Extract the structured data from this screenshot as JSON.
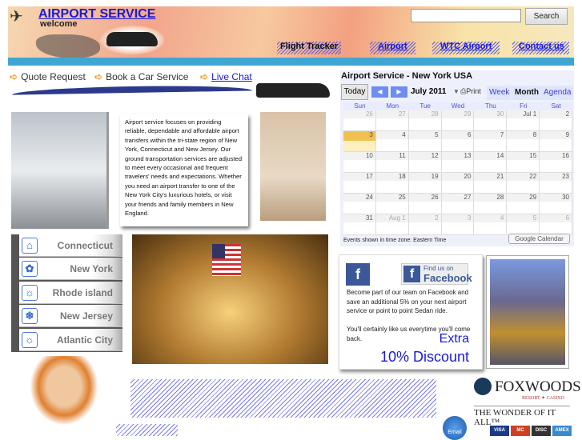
{
  "header": {
    "title": "AIRPORT SERVICE",
    "subtitle": "welcome",
    "search_placeholder": "",
    "search_button": "Search",
    "nav": [
      {
        "label": "Flight Tracker"
      },
      {
        "label": "Airport"
      },
      {
        "label": "WTC Airport"
      },
      {
        "label": "Contact us"
      }
    ]
  },
  "quick_links": [
    {
      "label": "Quote Request"
    },
    {
      "label": "Book a Car Service"
    },
    {
      "label": "Live Chat"
    }
  ],
  "calendar": {
    "title": "Airport Service - New York USA",
    "today": "Today",
    "month": "July 2011",
    "print": "Print",
    "views": [
      "Week",
      "Month",
      "Agenda"
    ],
    "days": [
      "Sun",
      "Mon",
      "Tue",
      "Wed",
      "Thu",
      "Fri",
      "Sat"
    ],
    "weeks": [
      [
        "26",
        "27",
        "28",
        "29",
        "30",
        "Jul 1",
        "2"
      ],
      [
        "3",
        "4",
        "5",
        "6",
        "7",
        "8",
        "9"
      ],
      [
        "10",
        "11",
        "12",
        "13",
        "14",
        "15",
        "16"
      ],
      [
        "17",
        "18",
        "19",
        "20",
        "21",
        "22",
        "23"
      ],
      [
        "24",
        "25",
        "26",
        "27",
        "28",
        "29",
        "30"
      ],
      [
        "31",
        "Aug 1",
        "2",
        "3",
        "4",
        "5",
        "6"
      ]
    ],
    "highlighted_day": "3",
    "timezone": "Events shown in time zone: Eastern Time",
    "google_button": "Google Calendar"
  },
  "intro": "Airport service focuses on providing reliable, dependable and affordable airport transfers within the tri-state region of New York, Connecticut and New Jersey. Our ground transportation services are adjusted to meet every occasional and frequent travelers' needs and expectations. Whether you need an airport transfer to one of the New York City's luxurious hotels, or visit your friends and family members in New England.",
  "sidebar": {
    "items": [
      {
        "label": "Connecticut",
        "icon": "house-icon"
      },
      {
        "label": "New York",
        "icon": "flower-icon"
      },
      {
        "label": "Rhode island",
        "icon": "sun-icon"
      },
      {
        "label": "New Jersey",
        "icon": "snowflake-icon"
      },
      {
        "label": "Atlantic City",
        "icon": "sun-icon"
      }
    ]
  },
  "facebook": {
    "find_us": "Find us on",
    "brand": "Facebook",
    "text1": "Become part of our team on Facebook and save an additional 5% on your next airport service or point to point Sedan ride.",
    "text2": "You'll certainly like us everytime you'll come back.",
    "extra": "Extra",
    "discount": "10% Discount"
  },
  "ads": {
    "foxwoods": "FOXWOODS",
    "foxwoods_sub": "RESORT ✦ CASINO",
    "foxwoods_tag": "THE WONDER OF IT ALL™",
    "email": "Email",
    "cards": [
      "VISA",
      "MC",
      "DISC",
      "AMEX"
    ]
  },
  "colors": {
    "link": "#1a1ad8",
    "strip": "#3fa6d4",
    "facebook": "#3b5998"
  }
}
